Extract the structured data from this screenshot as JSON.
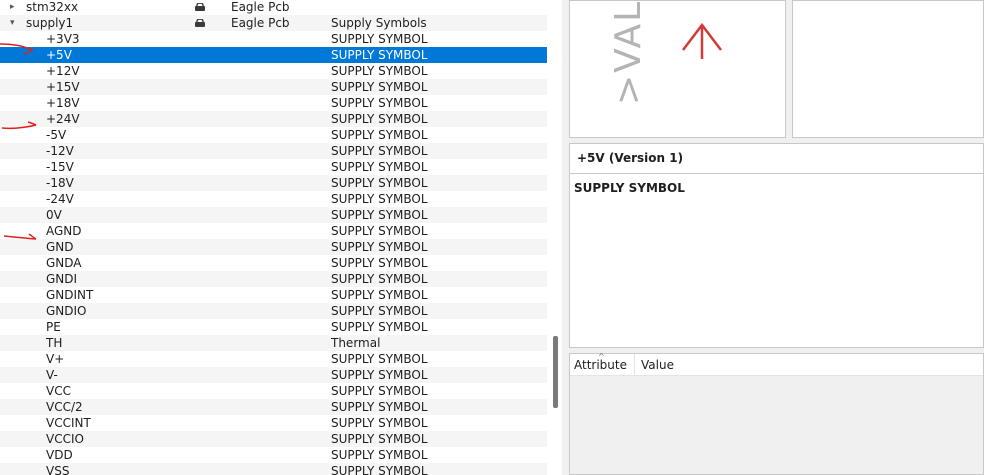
{
  "tree": {
    "rows": [
      {
        "kind": "lib",
        "expander": "▸",
        "name": "stm32xx",
        "lock": true,
        "type": "Eagle Pcb",
        "desc": ""
      },
      {
        "kind": "lib",
        "expander": "▾",
        "name": "supply1",
        "lock": true,
        "type": "Eagle Pcb",
        "desc": "Supply Symbols"
      },
      {
        "name": "+3V3",
        "desc": "SUPPLY SYMBOL"
      },
      {
        "name": "+5V",
        "desc": "SUPPLY SYMBOL",
        "selected": true
      },
      {
        "name": "+12V",
        "desc": "SUPPLY SYMBOL"
      },
      {
        "name": "+15V",
        "desc": "SUPPLY SYMBOL"
      },
      {
        "name": "+18V",
        "desc": "SUPPLY SYMBOL"
      },
      {
        "name": "+24V",
        "desc": "SUPPLY SYMBOL"
      },
      {
        "name": "-5V",
        "desc": "SUPPLY SYMBOL"
      },
      {
        "name": "-12V",
        "desc": "SUPPLY SYMBOL"
      },
      {
        "name": "-15V",
        "desc": "SUPPLY SYMBOL"
      },
      {
        "name": "-18V",
        "desc": "SUPPLY SYMBOL"
      },
      {
        "name": "-24V",
        "desc": "SUPPLY SYMBOL"
      },
      {
        "name": "0V",
        "desc": "SUPPLY SYMBOL"
      },
      {
        "name": "AGND",
        "desc": "SUPPLY SYMBOL"
      },
      {
        "name": "GND",
        "desc": "SUPPLY SYMBOL"
      },
      {
        "name": "GNDA",
        "desc": "SUPPLY SYMBOL"
      },
      {
        "name": "GNDI",
        "desc": "SUPPLY SYMBOL"
      },
      {
        "name": "GNDINT",
        "desc": "SUPPLY SYMBOL"
      },
      {
        "name": "GNDIO",
        "desc": "SUPPLY SYMBOL"
      },
      {
        "name": "PE",
        "desc": "SUPPLY SYMBOL"
      },
      {
        "name": "TH",
        "desc": "Thermal"
      },
      {
        "name": "V+",
        "desc": "SUPPLY SYMBOL"
      },
      {
        "name": "V-",
        "desc": "SUPPLY SYMBOL"
      },
      {
        "name": "VCC",
        "desc": "SUPPLY SYMBOL"
      },
      {
        "name": "VCC/2",
        "desc": "SUPPLY SYMBOL"
      },
      {
        "name": "VCCINT",
        "desc": "SUPPLY SYMBOL"
      },
      {
        "name": "VCCIO",
        "desc": "SUPPLY SYMBOL"
      },
      {
        "name": "VDD",
        "desc": "SUPPLY SYMBOL"
      },
      {
        "name": "VSS",
        "desc": "SUPPLY SYMBOL"
      }
    ]
  },
  "symbol_preview": {
    "value_text": ">VALUE"
  },
  "description": {
    "title": "+5V (Version 1)",
    "body": "SUPPLY SYMBOL"
  },
  "attributes": {
    "columns": [
      "Attribute",
      "Value"
    ]
  },
  "colors": {
    "selection": "#0078d7",
    "annotation_red": "#e0201c",
    "symbol_red": "#d23a3a"
  },
  "icons": {
    "lock": "lock-icon",
    "expand": "expand-arrow-icon",
    "collapse": "collapse-arrow-icon",
    "sort": "sort-up-icon"
  }
}
